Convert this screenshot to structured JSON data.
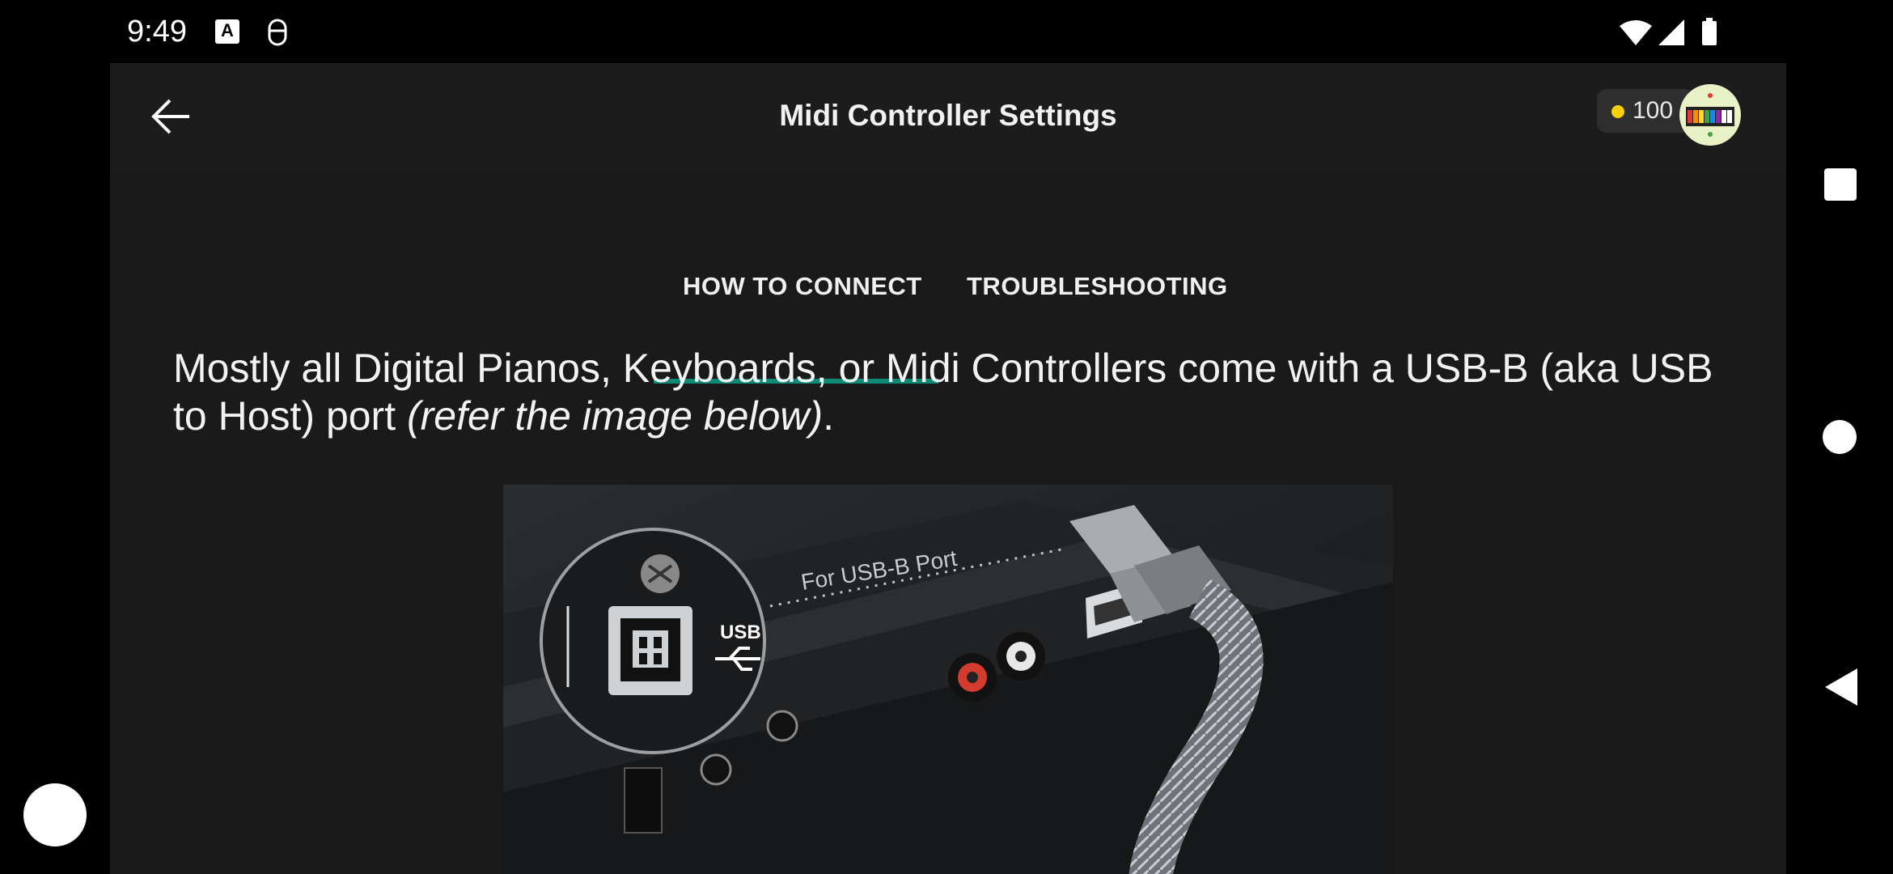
{
  "status_bar": {
    "time": "9:49",
    "left_icons": [
      "a-notification-icon",
      "keyboard-accessibility-icon"
    ],
    "right_icons": [
      "wifi-icon",
      "signal-icon",
      "battery-icon"
    ]
  },
  "header": {
    "title": "Midi Controller Settings",
    "back_icon": "arrow-left-icon",
    "coins": "100"
  },
  "tabs": [
    {
      "label": "HOW TO CONNECT",
      "selected": true
    },
    {
      "label": "TROUBLESHOOTING",
      "selected": false
    }
  ],
  "content": {
    "paragraph_main": "Mostly all Digital Pianos, Keyboards, or Midi Controllers come with a USB-B (aka USB to Host) port ",
    "paragraph_italic": "(refer the image below)",
    "paragraph_end": ".",
    "image": {
      "usb_label": "USB",
      "port_label": "For USB-B Port"
    }
  },
  "nav": {
    "icons": [
      "recents-square-icon",
      "home-circle-icon",
      "back-triangle-icon"
    ]
  },
  "colors": {
    "accent": "#0f8a77",
    "background": "#1a1a1a",
    "coin": "#f5d10a"
  }
}
